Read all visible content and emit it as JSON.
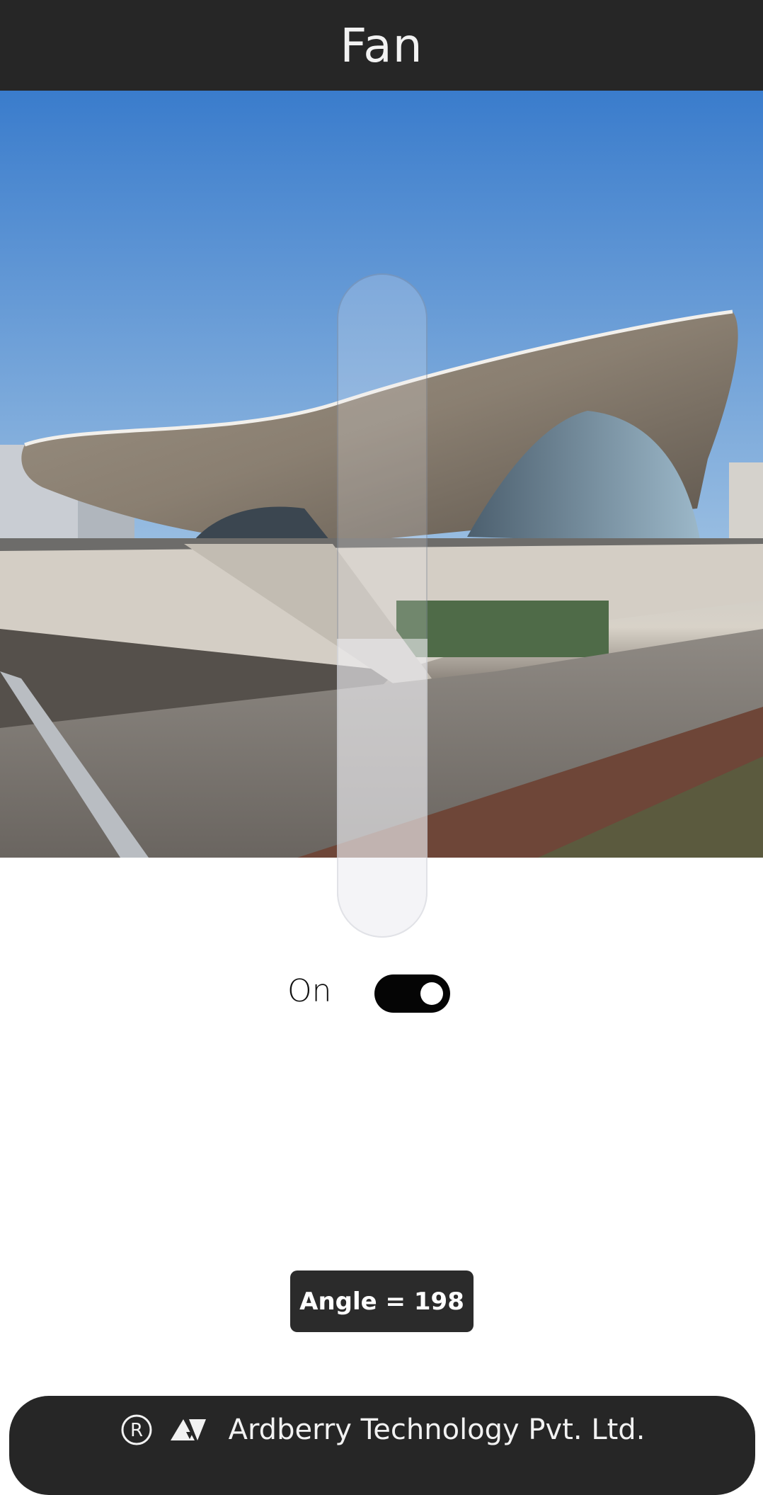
{
  "header": {
    "title": "Fan"
  },
  "hero": {
    "image_subject": "aquatics-centre-building-photo"
  },
  "slider": {
    "value_fraction": 0.45
  },
  "power_toggle": {
    "label": "On",
    "state": true
  },
  "angle_badge": {
    "text": "Angle = 198"
  },
  "footer": {
    "registered_icon": "registered-trademark-icon",
    "logo_icon": "company-logo-icon",
    "company_name": "Ardberry Technology Pvt. Ltd."
  },
  "colors": {
    "header_bg": "#262626",
    "toggle_on": "#050505",
    "badge_bg": "#2b2b2b",
    "footer_bg": "#262626"
  }
}
